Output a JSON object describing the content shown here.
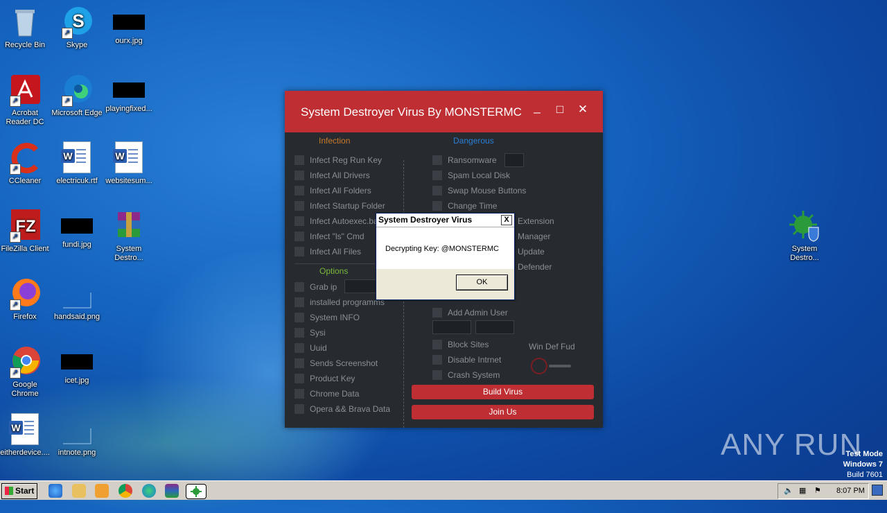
{
  "desktop": {
    "icons": [
      {
        "label": "Recycle Bin"
      },
      {
        "label": "Skype"
      },
      {
        "label": "ourx.jpg"
      },
      {
        "label": "Acrobat Reader DC"
      },
      {
        "label": "Microsoft Edge"
      },
      {
        "label": "playingfixed..."
      },
      {
        "label": "CCleaner"
      },
      {
        "label": "electricuk.rtf"
      },
      {
        "label": "websitesum..."
      },
      {
        "label": "FileZilla Client"
      },
      {
        "label": "fundi.jpg"
      },
      {
        "label": "System Destro..."
      },
      {
        "label": "Firefox"
      },
      {
        "label": "handsaid.png"
      },
      {
        "label": "Google Chrome"
      },
      {
        "label": "icet.jpg"
      },
      {
        "label": "eitherdevice...."
      },
      {
        "label": "intnote.png"
      },
      {
        "label": "System Destro..."
      }
    ]
  },
  "app": {
    "title": "System Destroyer Virus By MONSTERMC",
    "minimize": "_",
    "maximize": "□",
    "close": "✕",
    "infection_header": "Infection",
    "dangerous_header": "Dangerous",
    "options_header": "Options",
    "infection": [
      "Infect Reg Run Key",
      "Infect All Drivers",
      "Infect All Folders",
      "Infect Startup Folder",
      "Infect Autoexec.bat",
      "Infect \"ls\" Cmd",
      "Infect All  Files"
    ],
    "dangerous": [
      "Ransomware",
      "Spam Local Disk",
      "Swap Mouse Buttons",
      "Change Time",
      "Extension",
      "Manager",
      "Update",
      "Defender"
    ],
    "options": [
      "Grab ip",
      "installed programms",
      "System INFO",
      "Sysi",
      "Uuid",
      "Sends Screenshot",
      "Product Key",
      "Chrome Data",
      "Opera && Brava Data"
    ],
    "admin": "Add Admin User",
    "block": [
      "Block Sites",
      "Disable Intrnet",
      "Crash System"
    ],
    "win_def": "Win Def Fud",
    "build_btn": "Build Virus",
    "join_btn": "Join Us"
  },
  "msgbox": {
    "title": "System Destroyer Virus",
    "close": "X",
    "message": "Decrypting Key: @MONSTERMC",
    "ok": "OK"
  },
  "taskbar": {
    "start": "Start",
    "time": "8:07 PM"
  },
  "watermark": "ANY RUN",
  "testmode": {
    "line1": "Test Mode",
    "line2": "Windows 7",
    "line3": "Build 7601"
  },
  "colors": {
    "accent": "#bf2e33",
    "app_bg": "#272b30",
    "infection_header": "#c87a2a",
    "dangerous_header": "#2a7fd6",
    "options_header": "#7ab83a"
  }
}
